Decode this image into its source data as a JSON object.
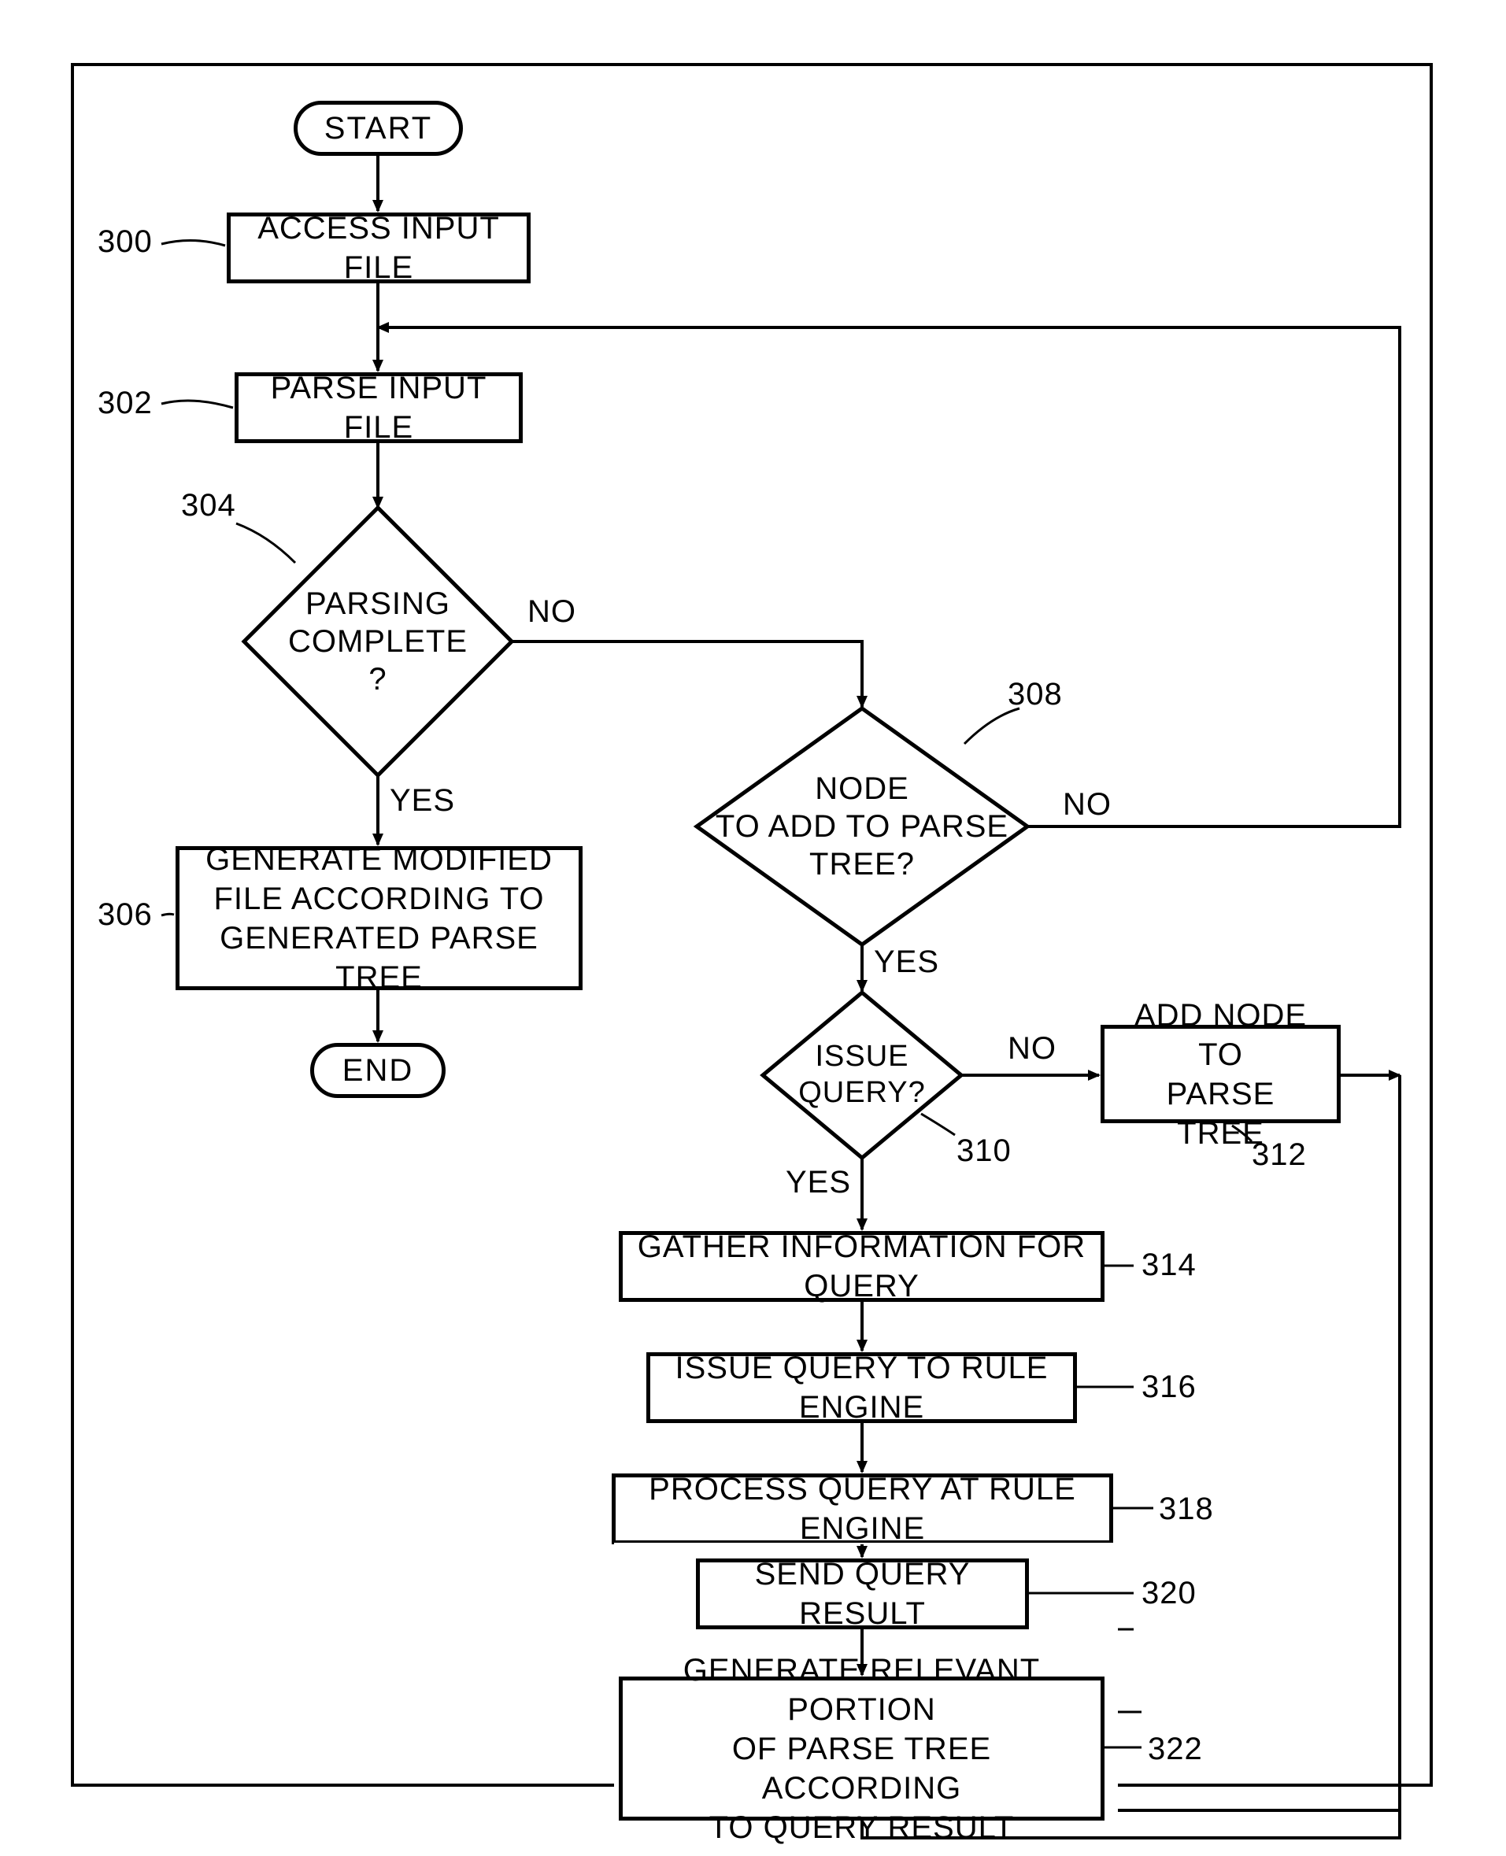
{
  "terminators": {
    "start": "START",
    "end": "END"
  },
  "processes": {
    "p300": "ACCESS INPUT FILE",
    "p302": "PARSE INPUT FILE",
    "p306": "GENERATE MODIFIED\nFILE ACCORDING TO\nGENERATED PARSE TREE",
    "p312": "ADD NODE TO\nPARSE TREE",
    "p314": "GATHER INFORMATION FOR QUERY",
    "p316": "ISSUE QUERY TO RULE ENGINE",
    "p318": "PROCESS QUERY AT RULE ENGINE",
    "p320": "SEND QUERY RESULT",
    "p322": "GENERATE RELEVANT PORTION\nOF PARSE TREE ACCORDING\nTO QUERY RESULT"
  },
  "decisions": {
    "d304": "PARSING\nCOMPLETE\n?",
    "d308": "NODE\nTO ADD TO PARSE\nTREE?",
    "d310": "ISSUE\nQUERY?"
  },
  "labels": {
    "yes": "YES",
    "no": "NO"
  },
  "refs": {
    "r300": "300",
    "r302": "302",
    "r304": "304",
    "r306": "306",
    "r308": "308",
    "r310": "310",
    "r312": "312",
    "r314": "314",
    "r316": "316",
    "r318": "318",
    "r320": "320",
    "r322": "322"
  }
}
